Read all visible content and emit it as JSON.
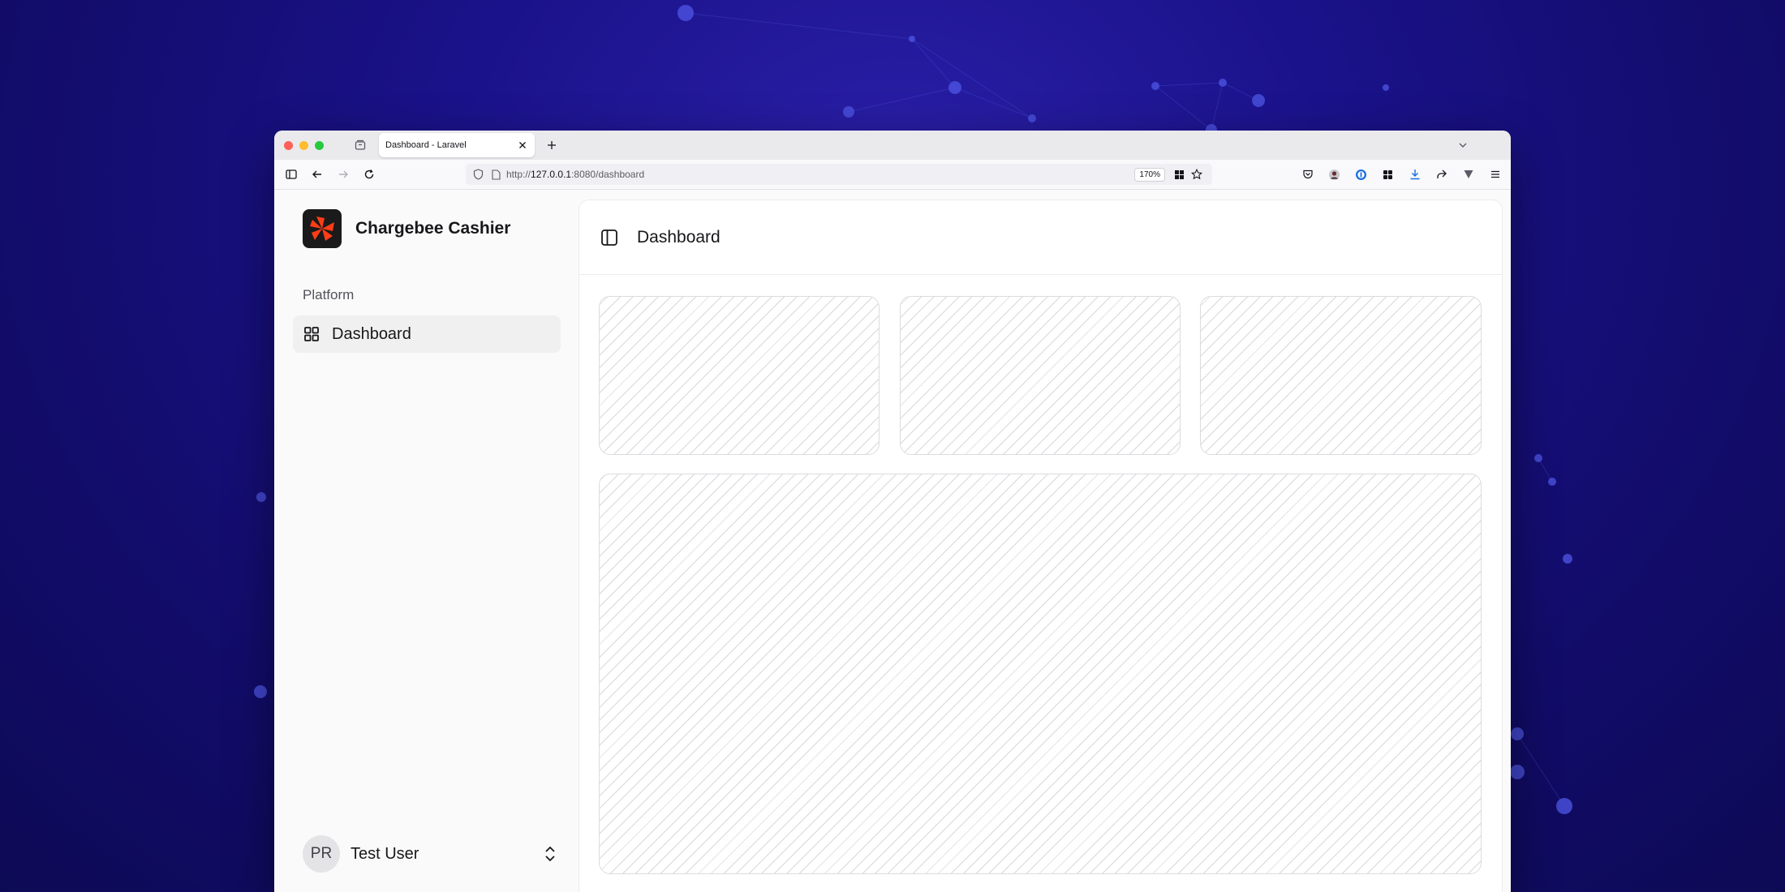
{
  "browser": {
    "tab_title": "Dashboard - Laravel",
    "url_prefix": "http://",
    "url_host": "127.0.0.1",
    "url_rest": ":8080/dashboard",
    "zoom": "170%"
  },
  "sidebar": {
    "brand_name": "Chargebee Cashier",
    "section_label": "Platform",
    "items": [
      {
        "label": "Dashboard",
        "icon": "layout-grid-icon",
        "active": true
      }
    ],
    "user": {
      "initials": "PR",
      "name": "Test User"
    }
  },
  "main": {
    "title": "Dashboard"
  },
  "colors": {
    "background": "#1a128a",
    "logo_accent": "#ff3d17",
    "active_nav": "#f0f0f0"
  }
}
